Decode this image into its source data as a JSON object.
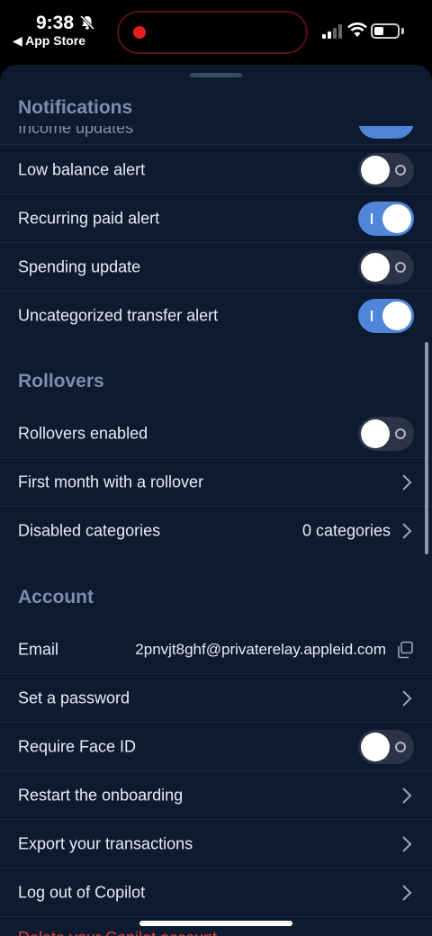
{
  "status_bar": {
    "time": "9:38",
    "back_label": "◀ App Store"
  },
  "partial_rows": {
    "top_label": "Income updates",
    "bottom_label": "Delete your Copilot account"
  },
  "notifications": {
    "title": "Notifications",
    "rows": [
      {
        "label": "Low balance alert",
        "enabled": false
      },
      {
        "label": "Recurring paid alert",
        "enabled": true
      },
      {
        "label": "Spending update",
        "enabled": false
      },
      {
        "label": "Uncategorized transfer alert",
        "enabled": true
      }
    ]
  },
  "rollovers": {
    "title": "Rollovers",
    "enabled_label": "Rollovers enabled",
    "enabled": false,
    "first_month_label": "First month with a rollover",
    "disabled_label": "Disabled categories",
    "disabled_value": "0 categories"
  },
  "account": {
    "title": "Account",
    "email_label": "Email",
    "email_value": "2pnvjt8ghf@privaterelay.appleid.com",
    "password_label": "Set a password",
    "face_id_label": "Require Face ID",
    "face_id_enabled": false,
    "restart_label": "Restart the onboarding",
    "export_label": "Export your transactions",
    "logout_label": "Log out of Copilot"
  },
  "colors": {
    "background": "#0d1a2f",
    "toggle_on": "#4f86d9",
    "toggle_off": "#2a3446",
    "section_title": "#7d8ead",
    "destructive": "#e0443a"
  }
}
